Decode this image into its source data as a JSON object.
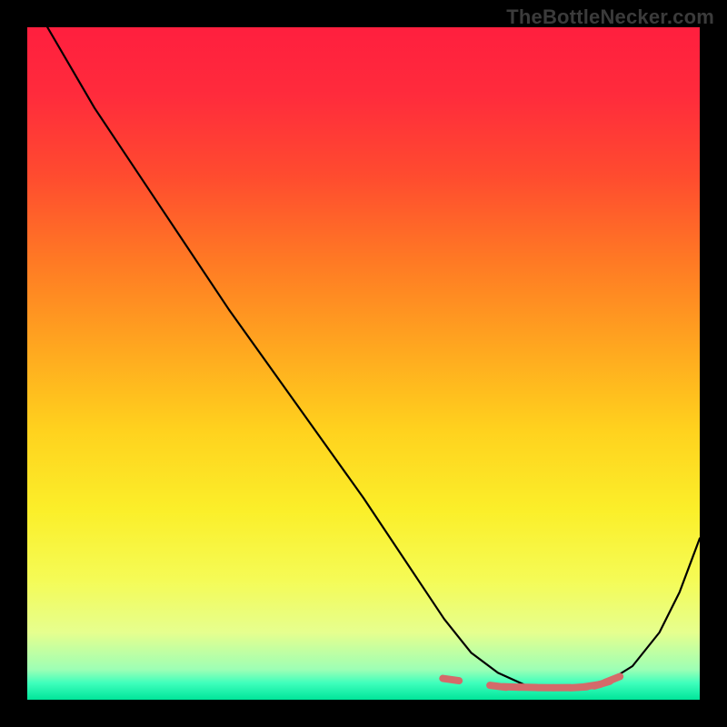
{
  "watermark": "TheBottleNecker.com",
  "gradient": {
    "stops": [
      {
        "offset": 0.0,
        "color": "#ff1f3e"
      },
      {
        "offset": 0.1,
        "color": "#ff2b3c"
      },
      {
        "offset": 0.22,
        "color": "#ff4b2f"
      },
      {
        "offset": 0.35,
        "color": "#ff7a24"
      },
      {
        "offset": 0.48,
        "color": "#ffa81f"
      },
      {
        "offset": 0.6,
        "color": "#ffd21e"
      },
      {
        "offset": 0.72,
        "color": "#fbef2a"
      },
      {
        "offset": 0.82,
        "color": "#f5fb55"
      },
      {
        "offset": 0.9,
        "color": "#e6ff8e"
      },
      {
        "offset": 0.955,
        "color": "#9dffb5"
      },
      {
        "offset": 0.975,
        "color": "#3fffbc"
      },
      {
        "offset": 1.0,
        "color": "#00e59a"
      }
    ]
  },
  "marker_color": "#d46a6a",
  "chart_data": {
    "type": "line",
    "title": "",
    "xlabel": "",
    "ylabel": "",
    "xlim": [
      0,
      100
    ],
    "ylim": [
      0,
      100
    ],
    "series": [
      {
        "name": "curve",
        "x": [
          3,
          10,
          20,
          30,
          40,
          50,
          58,
          62,
          66,
          70,
          74,
          78,
          82,
          86,
          90,
          94,
          97,
          100
        ],
        "y": [
          100,
          88,
          73,
          58,
          44,
          30,
          18,
          12,
          7,
          4,
          2.2,
          1.8,
          1.8,
          2.5,
          5,
          10,
          16,
          24
        ]
      },
      {
        "name": "markers",
        "x": [
          63,
          70,
          72,
          74.5,
          77,
          79.5,
          82,
          84,
          85.5,
          87
        ],
        "y": [
          3.0,
          2.0,
          1.9,
          1.85,
          1.8,
          1.8,
          1.85,
          2.1,
          2.4,
          3.0
        ]
      }
    ]
  }
}
